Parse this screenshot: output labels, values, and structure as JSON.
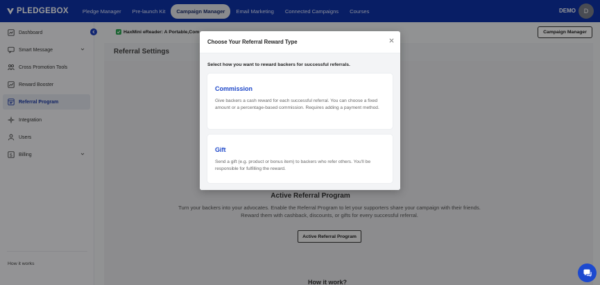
{
  "app": {
    "brand": "PLEDGEBOX"
  },
  "topnav": {
    "items": [
      {
        "label": "Pledge Manager",
        "active": false
      },
      {
        "label": "Pre-launch Kit",
        "active": false
      },
      {
        "label": "Campaign Manager",
        "active": true
      },
      {
        "label": "Email Marketing",
        "active": false
      },
      {
        "label": "Connected Campaigns",
        "active": false
      },
      {
        "label": "Courses",
        "active": false
      }
    ],
    "user_label": "DEMO",
    "avatar_initial": "D"
  },
  "sidebar": {
    "items": [
      {
        "label": "Dashboard",
        "icon": "dashboard-icon",
        "active": false
      },
      {
        "label": "Smart Message",
        "icon": "message-icon",
        "active": false,
        "expandable": true
      },
      {
        "label": "Cross Promotion Tools",
        "icon": "users-group-icon",
        "active": false
      },
      {
        "label": "Reward Booster",
        "icon": "chart-icon",
        "active": false
      },
      {
        "label": "Referral Program",
        "icon": "referral-icon",
        "active": true
      },
      {
        "label": "Integration",
        "icon": "integration-icon",
        "active": false
      },
      {
        "label": "Users",
        "icon": "user-icon",
        "active": false
      },
      {
        "label": "Billing",
        "icon": "billing-icon",
        "active": false,
        "expandable": true
      }
    ],
    "footer_link": "How it works"
  },
  "header": {
    "project_name": "HaxMini eReader: A Portable,Com",
    "campaign_manager_button": "Campaign Manager"
  },
  "main": {
    "page_title": "Referral Settings",
    "active_program_title": "Active Referral Program",
    "active_program_desc_1": "Turn your backers into your advocates. Enable the Referral Program to let your supporters share your campaign with their friends.",
    "active_program_desc_2": "Reward them with cashback, discounts, or gifts for every successful referral.",
    "active_program_button": "Active Referral Program",
    "how_it_work_title": "How it work?"
  },
  "modal": {
    "title": "Choose Your Referral Reward Type",
    "subtitle": "Select how you want to reward backers for successful referrals.",
    "options": [
      {
        "title": "Commission",
        "description": "Give backers a cash reward for each successful referral. You can choose a fixed amount or a percentage-based commission. Requires adding a payment method."
      },
      {
        "title": "Gift",
        "description": "Send a gift (e.g. product or bonus item) to backers who refer others. You'll be responsible for fulfilling the reward."
      }
    ]
  },
  "colors": {
    "topbar": "#0e33a8",
    "accent": "#1d47c9",
    "project_badge": "#2fa855"
  }
}
